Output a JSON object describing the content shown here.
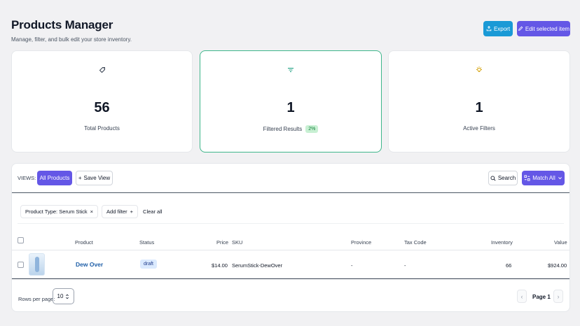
{
  "header": {
    "title": "Products Manager",
    "subtitle": "Manage, filter, and bulk edit your store inventory."
  },
  "actions": {
    "export_label": "Export",
    "edit_selected_label": "Edit selected item"
  },
  "stats": {
    "total": {
      "value": "56",
      "label": "Total Products",
      "icon": "tag-icon"
    },
    "filtered": {
      "value": "1",
      "label": "Filtered Results",
      "badge": "2%",
      "icon": "filter-lines-icon"
    },
    "active": {
      "value": "1",
      "label": "Active Filters",
      "icon": "lightbulb-icon"
    }
  },
  "toolbar": {
    "views_label": "VIEWS:",
    "all_products_label": "All Products",
    "save_view_label": "Save View",
    "search_label": "Search",
    "match_all_label": "Match All"
  },
  "filters": {
    "chips": [
      "Product Type: Serum Stick"
    ],
    "add_filter_label": "Add filter",
    "clear_all_label": "Clear all"
  },
  "table": {
    "columns": {
      "product": "Product",
      "status": "Status",
      "price": "Price",
      "sku": "SKU",
      "province": "Province",
      "tax_code": "Tax Code",
      "inventory": "Inventory",
      "value": "Value"
    },
    "rows": [
      {
        "product": "Dew Over",
        "status": "draft",
        "price": "$14.00",
        "sku": "SerumStick-DewOver",
        "province": "-",
        "tax_code": "-",
        "inventory": "66",
        "value": "$924.00"
      }
    ]
  },
  "pagination": {
    "rows_per_page_label": "Rows per page:",
    "rows_per_page_value": "10",
    "page_label": "Page 1"
  },
  "colors": {
    "accent": "#6457e6",
    "export": "#1a9ad6",
    "highlight_border": "#3fb68b",
    "link": "#1f5fa8"
  }
}
